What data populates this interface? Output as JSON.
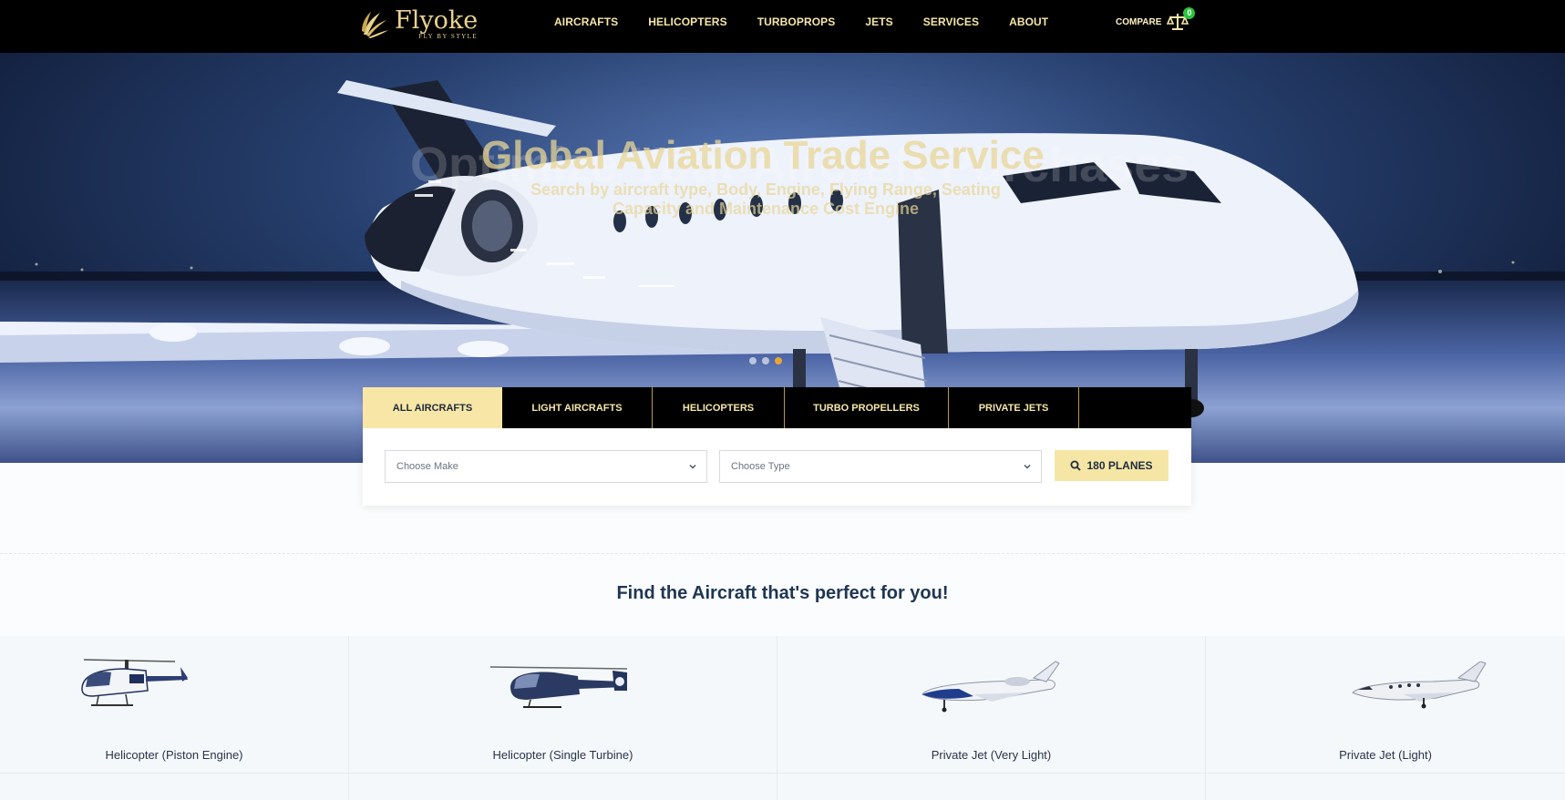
{
  "brand": {
    "name": "Flyoke",
    "tagline": "FLY BY STYLE",
    "accent": "#e9d28c"
  },
  "nav": {
    "items": [
      "AIRCRAFTS",
      "HELICOPTERS",
      "TURBOPROPS",
      "JETS",
      "SERVICES",
      "ABOUT"
    ]
  },
  "compare": {
    "label": "COMPARE",
    "count": "0",
    "icon": "scale-icon"
  },
  "hero": {
    "title": "Global Aviation Trade Service",
    "title_ghost": "Optimize Your Aircraft Purchases",
    "subtitle": "Search by aircraft type, Body, Engine, Flying Range, Seating Capacity and Maintenance Cost Engine",
    "slides": 3,
    "active_slide": 3
  },
  "search": {
    "tabs": [
      "ALL AIRCRAFTS",
      "LIGHT AIRCRAFTS",
      "HELICOPTERS",
      "TURBO PROPELLERS",
      "PRIVATE JETS"
    ],
    "active_tab": 0,
    "make_placeholder": "Choose Make",
    "type_placeholder": "Choose Type",
    "button_label": "180 PLANES",
    "button_icon": "search-icon"
  },
  "section": {
    "title": "Find the Aircraft that's perfect for you!"
  },
  "categories": [
    {
      "label": "Helicopter (Piston Engine)",
      "icon": "helicopter-piston-image"
    },
    {
      "label": "Helicopter (Single Turbine)",
      "icon": "helicopter-turbine-image"
    },
    {
      "label": "Private Jet (Very Light)",
      "icon": "jet-very-light-image"
    },
    {
      "label": "Private Jet (Light)",
      "icon": "jet-light-image"
    }
  ]
}
